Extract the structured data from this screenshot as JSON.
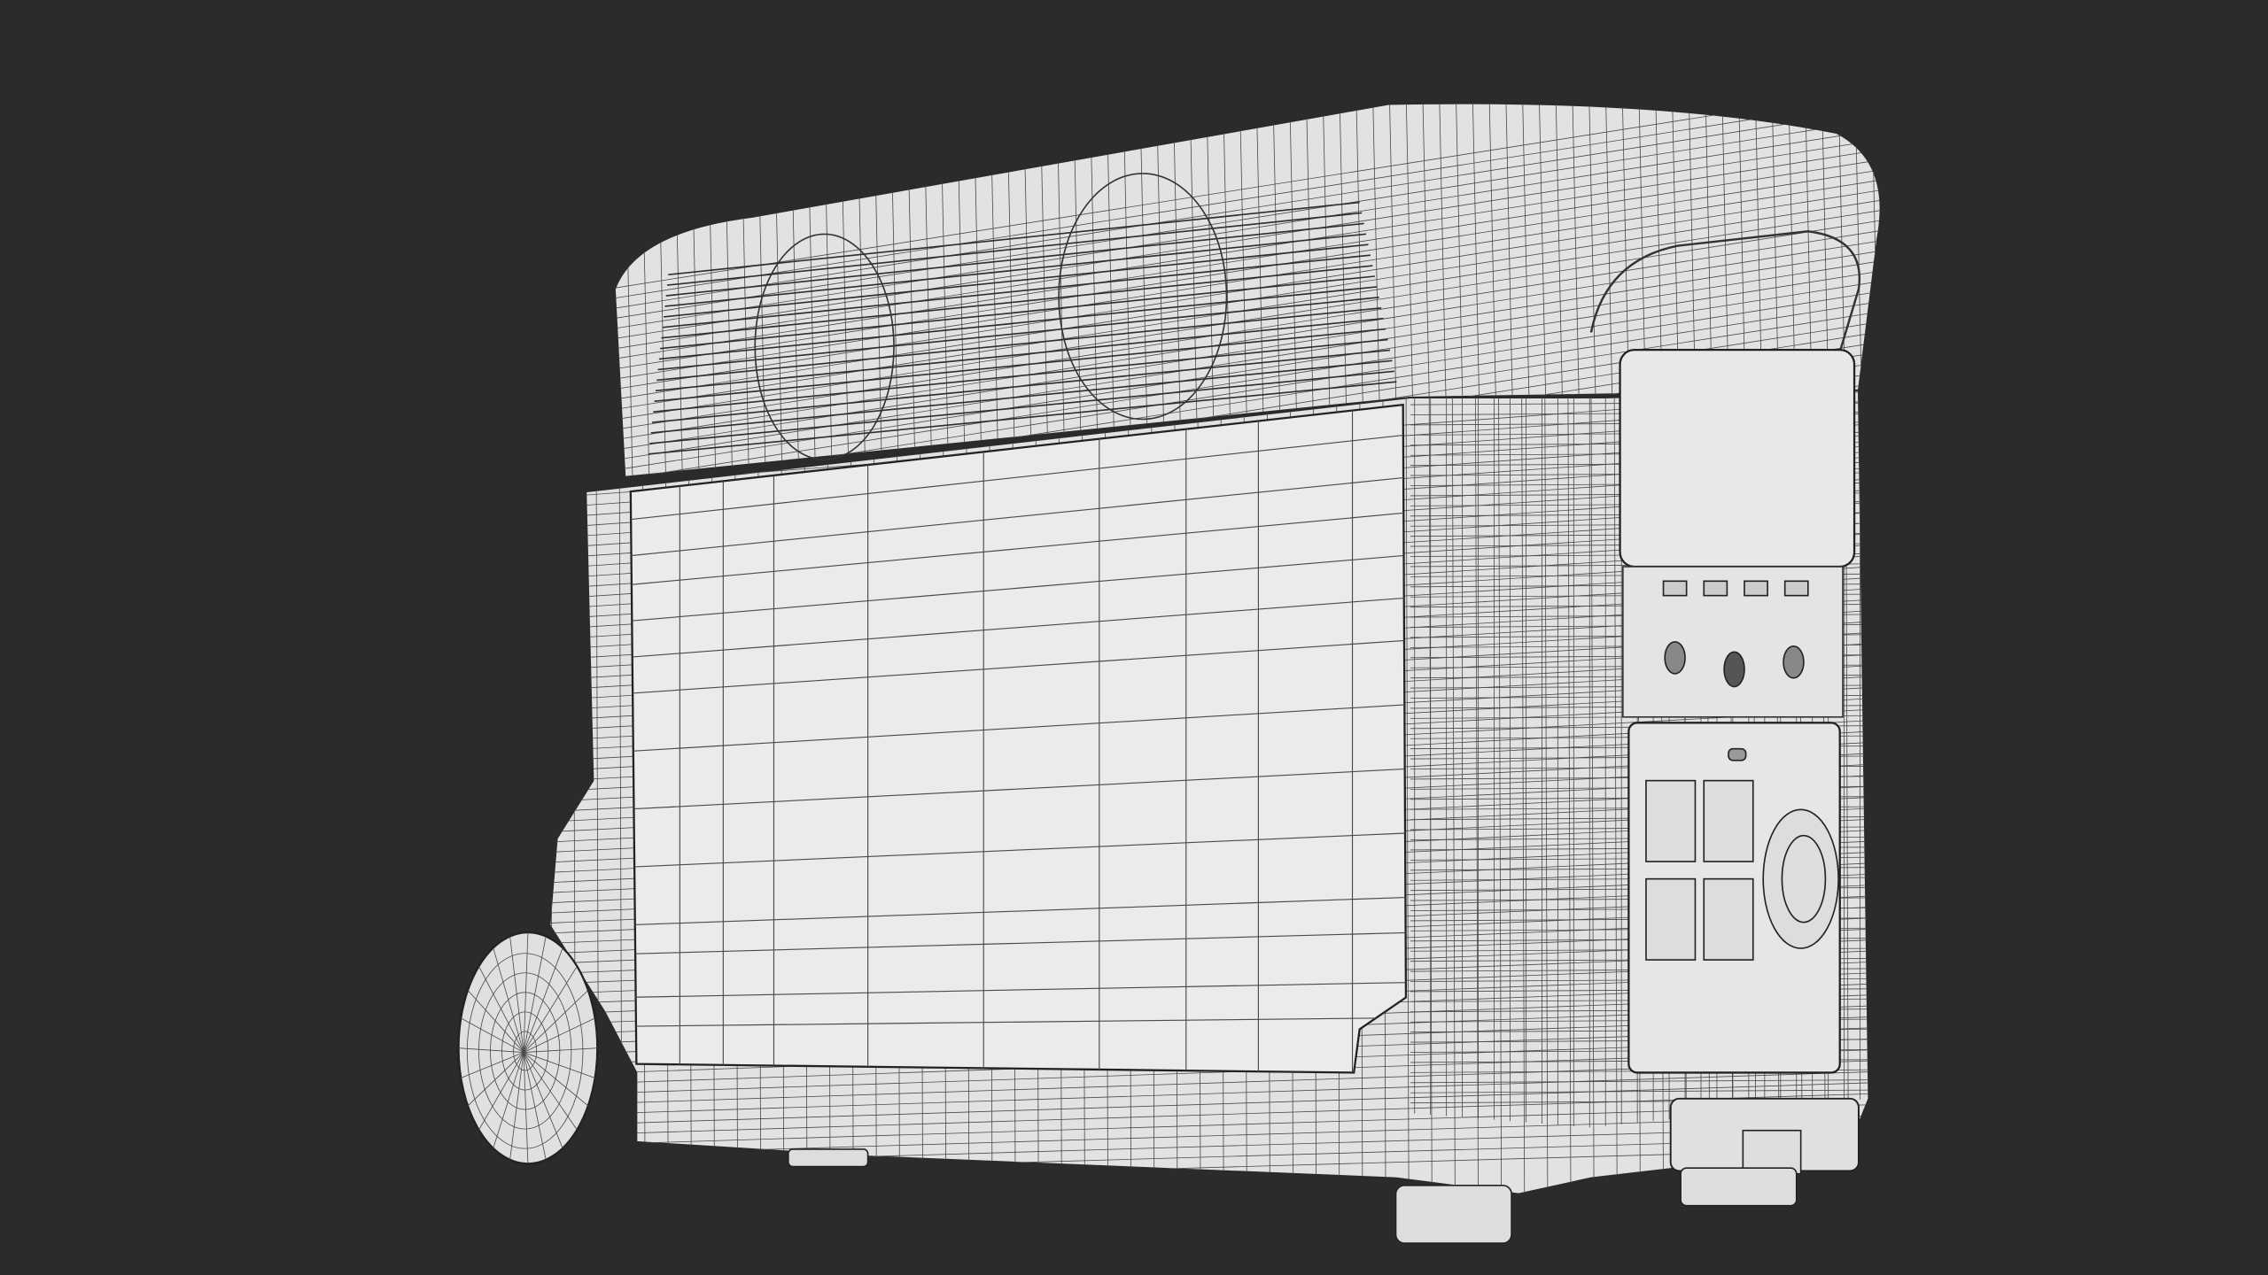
{
  "colors": {
    "background": "#2b2b2b",
    "body": "#e2e2e2",
    "panel": "#ececec",
    "wire": "#4a4a4a",
    "edge": "#2a2a2a"
  }
}
